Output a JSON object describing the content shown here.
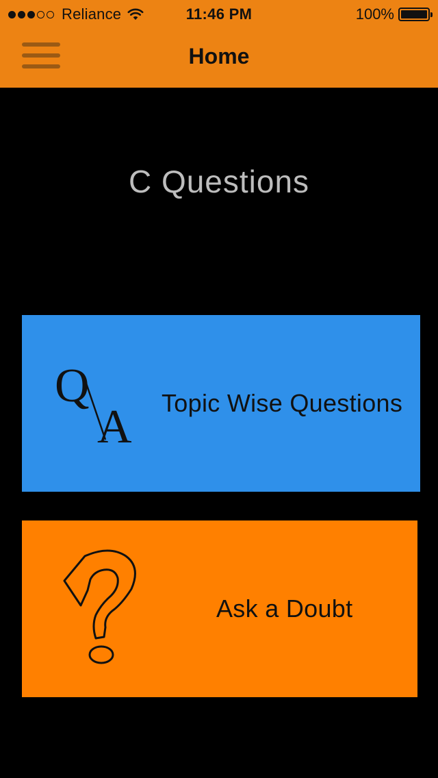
{
  "status_bar": {
    "carrier": "Reliance",
    "time": "11:46 PM",
    "battery": "100%",
    "signal_bars_filled": 3,
    "signal_bars_total": 5
  },
  "nav": {
    "title": "Home",
    "menu_icon": "hamburger-menu-icon"
  },
  "main": {
    "heading": "C Questions",
    "cards": [
      {
        "label": "Topic Wise Questions",
        "icon": "qa-icon",
        "color": "#2F90EA"
      },
      {
        "label": "Ask a Doubt",
        "icon": "question-mark-icon",
        "color": "#FF8000"
      }
    ]
  },
  "colors": {
    "header": "#ED8313",
    "background": "#000000",
    "heading_text": "#BDBDBD"
  }
}
